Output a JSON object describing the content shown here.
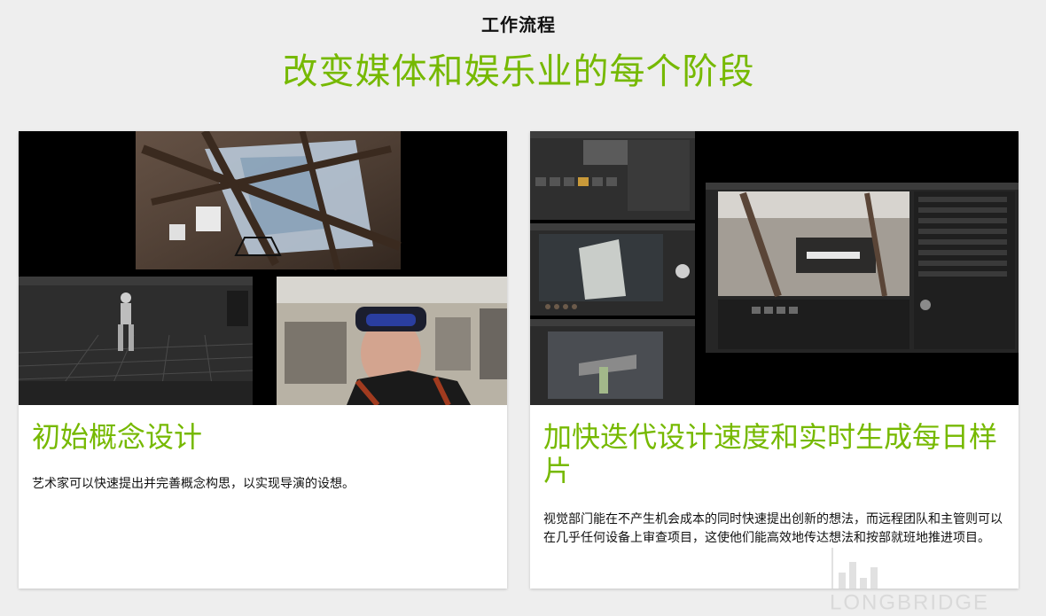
{
  "header": {
    "eyebrow": "工作流程",
    "headline": "改变媒体和娱乐业的每个阶段"
  },
  "cards": [
    {
      "title": "初始概念设计",
      "body": "艺术家可以快速提出并完善概念构思，以实现导演的设想。",
      "media_icon": "vr-concept-collage-image"
    },
    {
      "title": "加快迭代设计速度和实时生成每日样片",
      "body": "视觉部门能在不产生机会成本的同时快速提出创新的想法，而远程团队和主管则可以在几乎任何设备上审查项目，这使他们能高效地传达想法和按部就班地推进项目。",
      "media_icon": "realtime-review-screens-image"
    }
  ],
  "watermark": {
    "text": "LONGBRIDGE",
    "icon": "bar-chart-logo-icon"
  },
  "colors": {
    "accent": "#76b900",
    "background": "#eeeeee",
    "card": "#ffffff",
    "text": "#111111"
  }
}
